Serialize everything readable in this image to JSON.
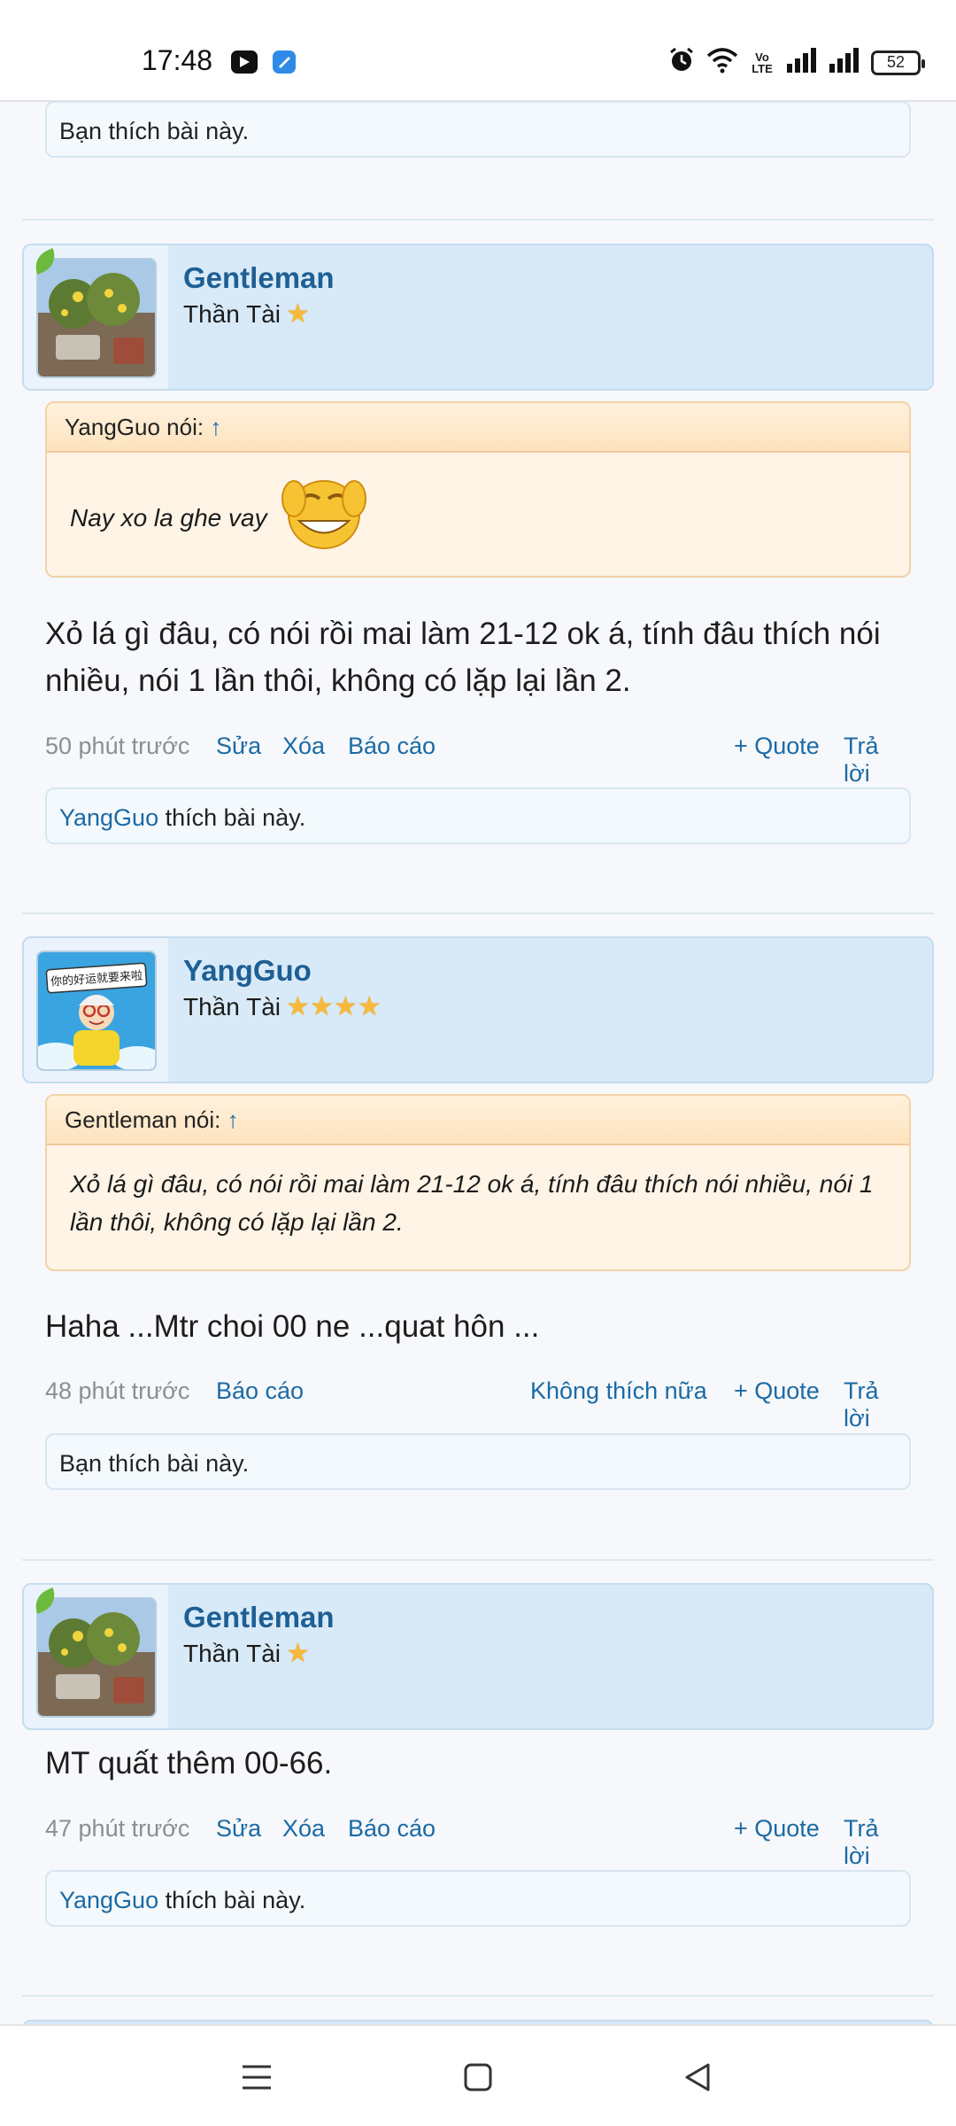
{
  "status_bar": {
    "time": "17:48",
    "battery": "52",
    "icons": [
      "app-icon-1",
      "app-icon-2",
      "alarm-icon",
      "wifi-icon",
      "volte-icon",
      "signal-icon",
      "signal-icon",
      "battery-icon"
    ],
    "volte_label": "Vo LTE"
  },
  "top_like": {
    "text": "Bạn thích bài này."
  },
  "posts": [
    {
      "user": "Gentleman",
      "title": "Thần Tài",
      "stars": 1,
      "quote": {
        "author_label": "YangGuo nói:",
        "arrow": "↑",
        "text": "Nay xo la ghe vay"
      },
      "text": "Xỏ lá gì đâu, có nói rồi mai làm 21-12 ok á, tính đâu thích nói nhiều, nói 1 lần thôi, không có lặp lại lần 2.",
      "time": "50 phút trước",
      "actions": {
        "edit": "Sửa",
        "delete": "Xóa",
        "report": "Báo cáo",
        "quote": "+ Quote",
        "reply": "Trả lời"
      },
      "like": {
        "user": "YangGuo",
        "suffix": " thích bài này."
      }
    },
    {
      "user": "YangGuo",
      "title": "Thần Tài",
      "stars": 4,
      "quote": {
        "author_label": "Gentleman nói:",
        "arrow": "↑",
        "text": "Xỏ lá gì đâu, có nói rồi mai làm 21-12 ok á, tính đâu thích nói nhiều, nói 1 lần thôi, không có lặp lại lần 2."
      },
      "text": "Haha ...Mtr choi 00 ne ...quat hôn ...",
      "time": "48 phút trước",
      "actions": {
        "report": "Báo cáo",
        "unlike": "Không thích nữa",
        "quote": "+ Quote",
        "reply": "Trả lời"
      },
      "like": {
        "text": "Bạn thích bài này."
      }
    },
    {
      "user": "Gentleman",
      "title": "Thần Tài",
      "stars": 1,
      "text": "MT quất thêm 00-66.",
      "time": "47 phút trước",
      "actions": {
        "edit": "Sửa",
        "delete": "Xóa",
        "report": "Báo cáo",
        "quote": "+ Quote",
        "reply": "Trả lời"
      },
      "like": {
        "user": "YangGuo",
        "suffix": " thích bài này."
      }
    }
  ],
  "nav_bar": {
    "buttons": [
      "menu-icon",
      "home-icon",
      "back-icon"
    ]
  },
  "colors": {
    "accent": "#1b6aa5",
    "user_card": "#d8eaf8",
    "quote_bg": "#fff4e6",
    "star": "#f6b93b"
  }
}
